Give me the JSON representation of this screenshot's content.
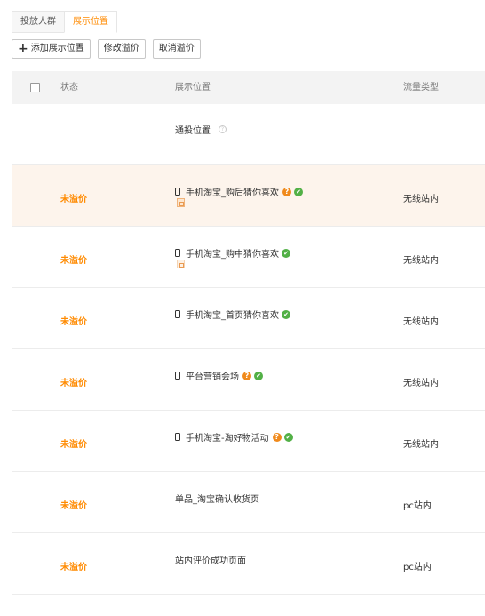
{
  "tabs": [
    {
      "label": "投放人群"
    },
    {
      "label": "展示位置"
    }
  ],
  "toolbar": {
    "add_label": "添加展示位置",
    "edit_label": "修改溢价",
    "cancel_label": "取消溢价"
  },
  "table": {
    "headers": {
      "status": "状态",
      "position": "展示位置",
      "traffic": "流量类型"
    },
    "general_row": {
      "position": "通投位置"
    },
    "rows": [
      {
        "status": "未溢价",
        "position": "手机淘宝_购后猜你喜欢",
        "traffic": "无线站内"
      },
      {
        "status": "未溢价",
        "position": "手机淘宝_购中猜你喜欢",
        "traffic": "无线站内"
      },
      {
        "status": "未溢价",
        "position": "手机淘宝_首页猜你喜欢",
        "traffic": "无线站内"
      },
      {
        "status": "未溢价",
        "position": "平台营销会场",
        "traffic": "无线站内"
      },
      {
        "status": "未溢价",
        "position": "手机淘宝-淘好物活动",
        "traffic": "无线站内"
      },
      {
        "status": "未溢价",
        "position": "单品_淘宝确认收货页",
        "traffic": "pc站内"
      },
      {
        "status": "未溢价",
        "position": "站内评价成功页面",
        "traffic": "pc站内"
      }
    ]
  },
  "colors": {
    "accent": "#ff8a00",
    "highlight_row": "#fdf4ec",
    "ok": "#52b046",
    "question": "#f08a1c"
  },
  "icons": {
    "question_glyph": "?",
    "ok_glyph": "✔",
    "help_glyph": "?"
  }
}
